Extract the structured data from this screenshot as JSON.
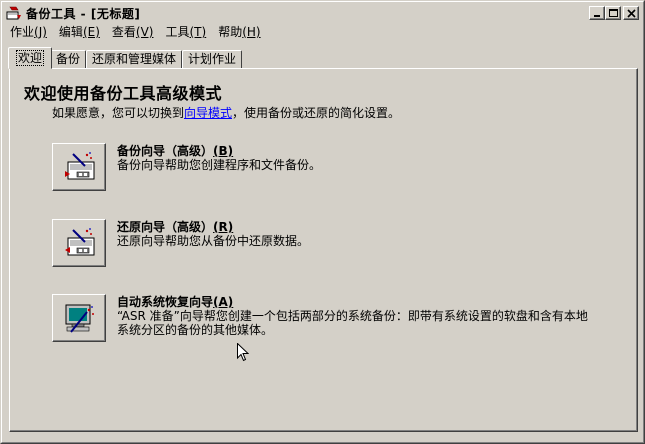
{
  "window": {
    "title": "备份工具 - [无标题]"
  },
  "menu": [
    {
      "label": "作业",
      "accel": "(J)"
    },
    {
      "label": "编辑",
      "accel": "(E)"
    },
    {
      "label": "查看",
      "accel": "(V)"
    },
    {
      "label": "工具",
      "accel": "(T)"
    },
    {
      "label": "帮助",
      "accel": "(H)"
    }
  ],
  "tabs": [
    "欢迎",
    "备份",
    "还原和管理媒体",
    "计划作业"
  ],
  "welcome": {
    "heading": "欢迎使用备份工具高级模式",
    "intro_prefix": "如果愿意，您可以切换到",
    "intro_link": "向导模式",
    "intro_suffix": "，使用备份或还原的简化设置。"
  },
  "wizards": [
    {
      "title": "备份向导（高级）",
      "accel": "(B)",
      "desc": "备份向导帮助您创建程序和文件备份。"
    },
    {
      "title": "还原向导（高级）",
      "accel": "(R)",
      "desc": "还原向导帮助您从备份中还原数据。"
    },
    {
      "title": "自动系统恢复向导",
      "accel": "(A)",
      "desc_line1": "“ASR 准备”向导帮您创建一个包括两部分的系统备份：即带有系统设置的软盘和含有本地",
      "desc_line2": "系统分区的备份的其他媒体。"
    }
  ],
  "icons": {
    "app": "backup-app-icon",
    "minimize": "minimize-icon",
    "maximize": "maximize-icon",
    "close": "close-icon",
    "backup_wizard": "backup-wizard-icon",
    "restore_wizard": "restore-wizard-icon",
    "asr_wizard": "asr-wizard-icon"
  }
}
